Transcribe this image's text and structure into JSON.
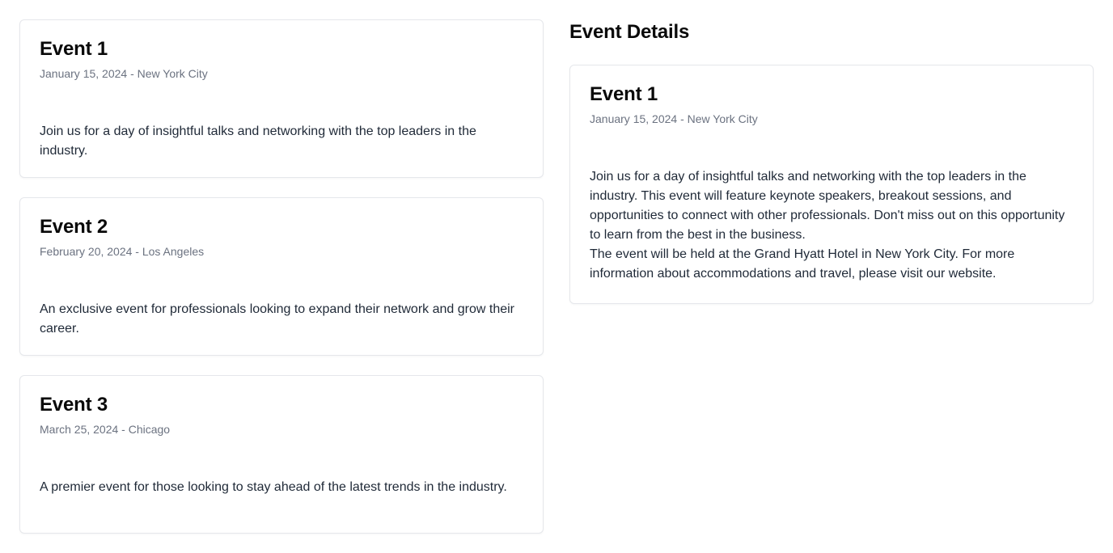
{
  "events": [
    {
      "title": "Event 1",
      "meta": "January 15, 2024 - New York City",
      "description": "Join us for a day of insightful talks and networking with the top leaders in the industry."
    },
    {
      "title": "Event 2",
      "meta": "February 20, 2024 - Los Angeles",
      "description": "An exclusive event for professionals looking to expand their network and grow their career."
    },
    {
      "title": "Event 3",
      "meta": "March 25, 2024 - Chicago",
      "description": "A premier event for those looking to stay ahead of the latest trends in the industry."
    }
  ],
  "details": {
    "heading": "Event Details",
    "title": "Event 1",
    "meta": "January 15, 2024 - New York City",
    "paragraph_1": "Join us for a day of insightful talks and networking with the top leaders in the industry. This event will feature keynote speakers, breakout sessions, and opportunities to connect with other professionals. Don't miss out on this opportunity to learn from the best in the business.",
    "paragraph_2": "The event will be held at the Grand Hyatt Hotel in New York City. For more information about accommodations and travel, please visit our website."
  }
}
